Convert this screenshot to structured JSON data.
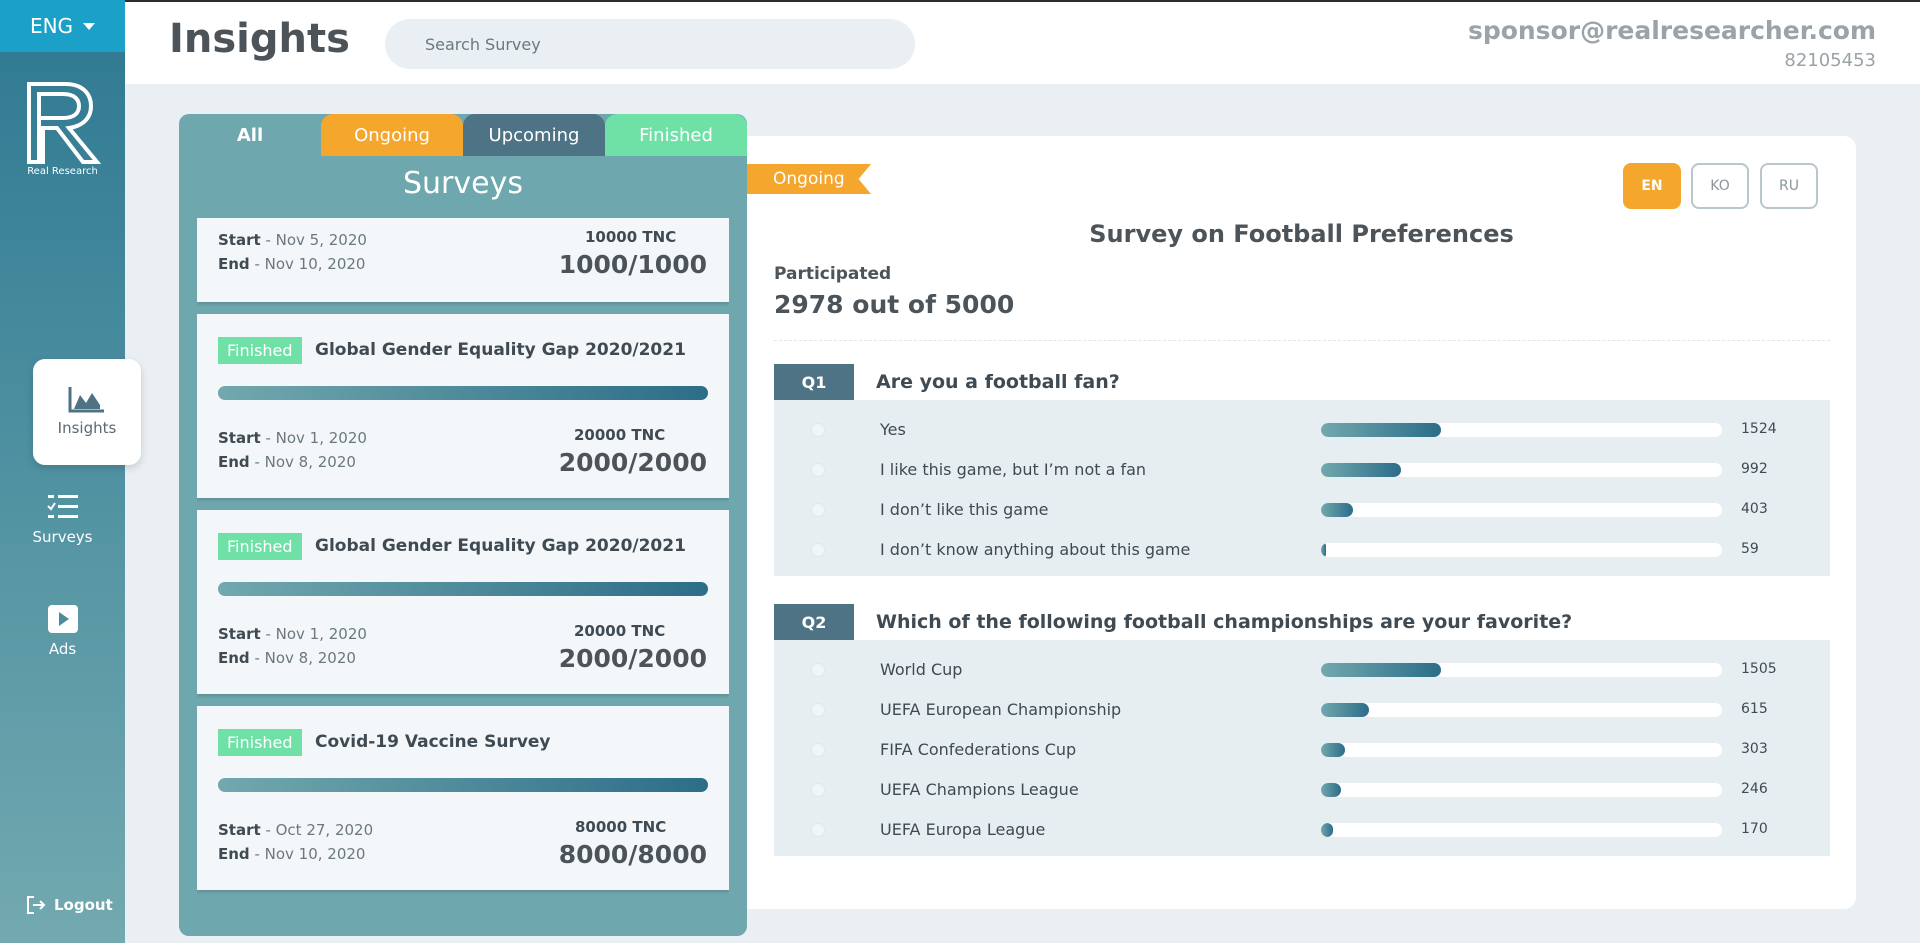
{
  "sidebar": {
    "language": "ENG",
    "logo_text": "Real Research",
    "nav": {
      "insights": "Insights",
      "surveys": "Surveys",
      "ads": "Ads"
    },
    "logout": "Logout"
  },
  "header": {
    "title": "Insights",
    "search_placeholder": "Search Survey",
    "email": "sponsor@realresearcher.com",
    "user_id": "82105453"
  },
  "survey_panel": {
    "tabs": {
      "all": "All",
      "ongoing": "Ongoing",
      "upcoming": "Upcoming",
      "finished": "Finished"
    },
    "title": "Surveys",
    "start_label": "Start",
    "end_label": "End",
    "cards": [
      {
        "badge": "",
        "title": "",
        "start": "Nov 5, 2020",
        "end": "Nov 10, 2020",
        "reward": "10000 TNC",
        "count": "1000/1000",
        "progress": 1.0
      },
      {
        "badge": "Finished",
        "title": "Global Gender Equality Gap 2020/2021",
        "start": "Nov 1, 2020",
        "end": "Nov 8, 2020",
        "reward": "20000 TNC",
        "count": "2000/2000",
        "progress": 1.0
      },
      {
        "badge": "Finished",
        "title": "Global Gender Equality Gap 2020/2021",
        "start": "Nov 1, 2020",
        "end": "Nov 8, 2020",
        "reward": "20000 TNC",
        "count": "2000/2000",
        "progress": 1.0
      },
      {
        "badge": "Finished",
        "title": "Covid-19 Vaccine Survey",
        "start": "Oct 27, 2020",
        "end": "Nov 10, 2020",
        "reward": "80000 TNC",
        "count": "8000/8000",
        "progress": 1.0
      }
    ]
  },
  "detail": {
    "status": "Ongoing",
    "languages": [
      "EN",
      "KO",
      "RU"
    ],
    "active_language": "EN",
    "title": "Survey on Football Preferences",
    "participated_label": "Participated",
    "participated_value": "2978 out of 5000",
    "questions": [
      {
        "num": "Q1",
        "text": "Are you a football fan?",
        "answers": [
          {
            "label": "Yes",
            "count": "1524",
            "ratio": 0.3
          },
          {
            "label": "I like this game, but I’m not a fan",
            "count": "992",
            "ratio": 0.2
          },
          {
            "label": "I don’t like this game",
            "count": "403",
            "ratio": 0.08
          },
          {
            "label": "I don’t know anything about this game",
            "count": "59",
            "ratio": 0.012
          }
        ]
      },
      {
        "num": "Q2",
        "text": "Which of the following football championships are your favorite?",
        "answers": [
          {
            "label": "World Cup",
            "count": "1505",
            "ratio": 0.3
          },
          {
            "label": "UEFA European Championship",
            "count": "615",
            "ratio": 0.12
          },
          {
            "label": "FIFA Confederations Cup",
            "count": "303",
            "ratio": 0.06
          },
          {
            "label": "UEFA Champions League",
            "count": "246",
            "ratio": 0.05
          },
          {
            "label": "UEFA Europa League",
            "count": "170",
            "ratio": 0.03
          }
        ]
      }
    ]
  },
  "colors": {
    "accent_orange": "#f5a62d",
    "finished_green": "#6fe0a6",
    "upcoming_slate": "#4e7384",
    "sidebar_top": "#2e7891",
    "lang_blue": "#1ba0c7"
  }
}
